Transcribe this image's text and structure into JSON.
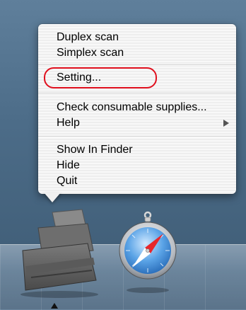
{
  "menu": {
    "items": [
      {
        "label": "Duplex scan"
      },
      {
        "label": "Simplex scan"
      },
      {
        "label": "Setting..."
      },
      {
        "label": "Check consumable supplies..."
      },
      {
        "label": "Help",
        "has_submenu": true
      },
      {
        "label": "Show In Finder"
      },
      {
        "label": "Hide"
      },
      {
        "label": "Quit"
      }
    ],
    "highlight_color": "#e0101e"
  },
  "dock": {
    "apps": [
      {
        "name": "scanner-icon"
      },
      {
        "name": "safari-compass-icon"
      }
    ]
  }
}
